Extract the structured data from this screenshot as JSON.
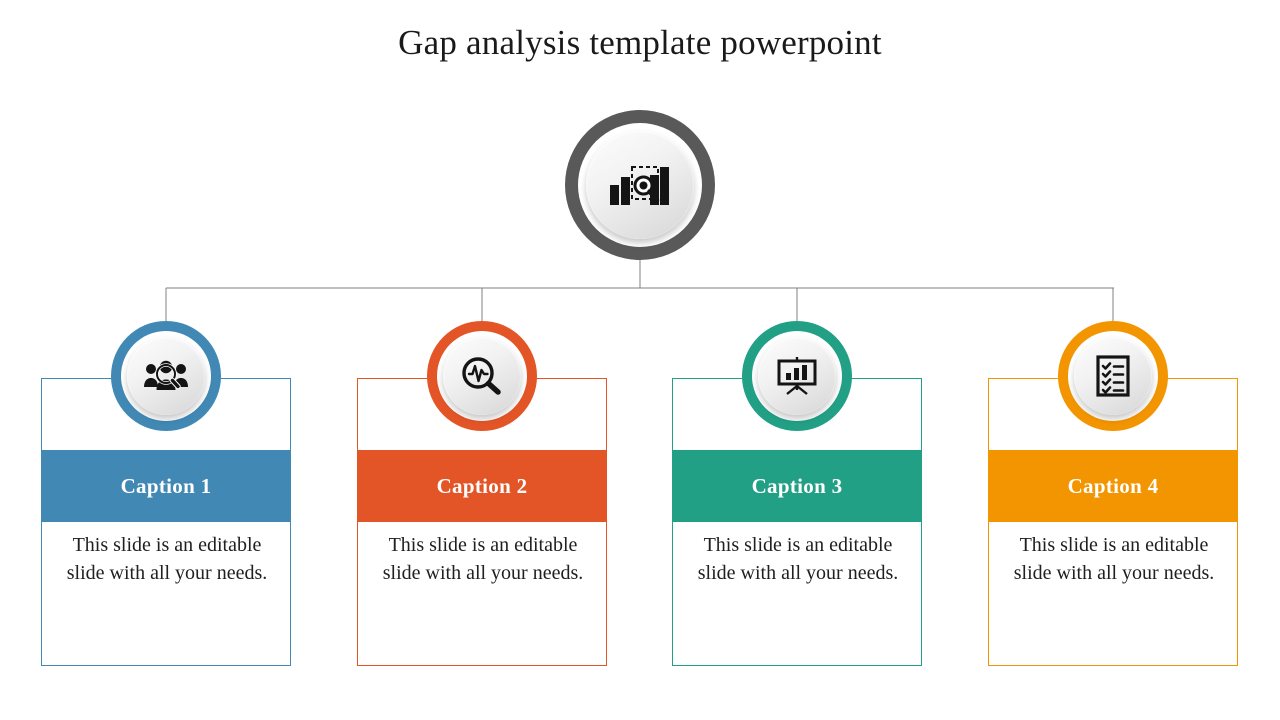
{
  "slide": {
    "title": "Gap analysis template powerpoint",
    "background_color": "#ffffff"
  },
  "center_node": {
    "icon": "bar-chart-magnifier-icon",
    "ring_color": "#595959"
  },
  "connector": {
    "color": "#808080",
    "style": "orthogonal-tree"
  },
  "cards": [
    {
      "caption": "Caption 1",
      "body": "This slide is an editable slide with all your needs.",
      "color": "#4189b4",
      "icon": "people-search-icon"
    },
    {
      "caption": "Caption 2",
      "body": "This slide is an editable slide with all your needs.",
      "color": "#e35527",
      "icon": "magnifier-pulse-icon"
    },
    {
      "caption": "Caption 3",
      "body": "This slide is an editable slide with all your needs.",
      "color": "#22a085",
      "icon": "presentation-chart-icon"
    },
    {
      "caption": "Caption 4",
      "body": "This slide is an editable slide with all your needs.",
      "color": "#f39500",
      "icon": "checklist-clipboard-icon"
    }
  ]
}
